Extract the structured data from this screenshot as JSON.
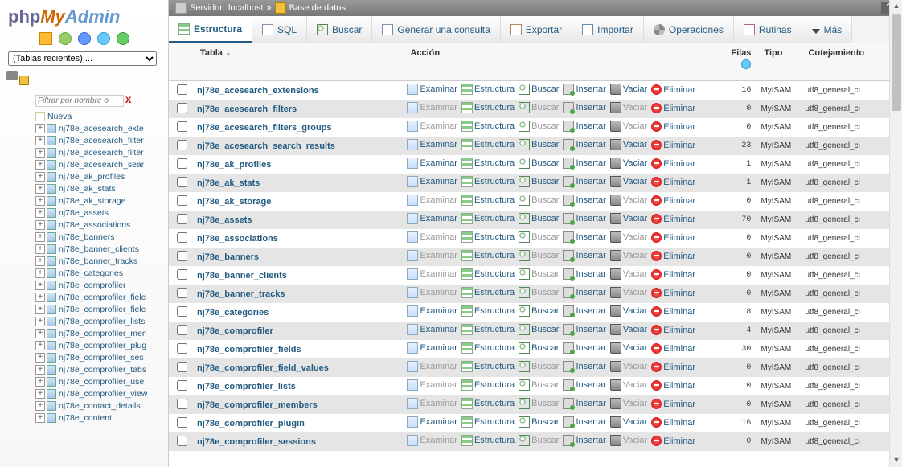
{
  "logo": {
    "p1": "php",
    "p2": "My",
    "p3": "Admin"
  },
  "sidebar": {
    "recent_placeholder": "(Tablas recientes) ...",
    "filter_placeholder": "Filtrar por nombre o",
    "filter_x": "X",
    "new_label": "Nueva",
    "tree": [
      "nj78e_acesearch_exte",
      "nj78e_acesearch_filter",
      "nj78e_acesearch_filter",
      "nj78e_acesearch_sear",
      "nj78e_ak_profiles",
      "nj78e_ak_stats",
      "nj78e_ak_storage",
      "nj78e_assets",
      "nj78e_associations",
      "nj78e_banners",
      "nj78e_banner_clients",
      "nj78e_banner_tracks",
      "nj78e_categories",
      "nj78e_comprofiler",
      "nj78e_comprofiler_fielc",
      "nj78e_comprofiler_fielc",
      "nj78e_comprofiler_lists",
      "nj78e_comprofiler_men",
      "nj78e_comprofiler_plug",
      "nj78e_comprofiler_ses",
      "nj78e_comprofiler_tabs",
      "nj78e_comprofiler_use",
      "nj78e_comprofiler_view",
      "nj78e_contact_details",
      "nj78e_content"
    ]
  },
  "breadcrumb": {
    "server_label": "Servidor:",
    "server_name": "localhost",
    "db_label": "Base de datos:",
    "db_name": ""
  },
  "topmenu": {
    "structure": "Estructura",
    "sql": "SQL",
    "search": "Buscar",
    "query": "Generar una consulta",
    "export": "Exportar",
    "import": "Importar",
    "operations": "Operaciones",
    "routines": "Rutinas",
    "more": "Más"
  },
  "headers": {
    "table": "Tabla",
    "action": "Acción",
    "rows": "Filas",
    "type": "Tipo",
    "collation": "Cotejamiento"
  },
  "actions": {
    "browse": "Examinar",
    "structure": "Estructura",
    "search": "Buscar",
    "insert": "Insertar",
    "empty": "Vaciar",
    "drop": "Eliminar"
  },
  "tables": [
    {
      "name": "nj78e_acesearch_extensions",
      "rows": 16,
      "type": "MyISAM",
      "collation": "utf8_general_ci",
      "empty": false
    },
    {
      "name": "nj78e_acesearch_filters",
      "rows": 0,
      "type": "MyISAM",
      "collation": "utf8_general_ci",
      "empty": true
    },
    {
      "name": "nj78e_acesearch_filters_groups",
      "rows": 0,
      "type": "MyISAM",
      "collation": "utf8_general_ci",
      "empty": true
    },
    {
      "name": "nj78e_acesearch_search_results",
      "rows": 23,
      "type": "MyISAM",
      "collation": "utf8_general_ci",
      "empty": false
    },
    {
      "name": "nj78e_ak_profiles",
      "rows": 1,
      "type": "MyISAM",
      "collation": "utf8_general_ci",
      "empty": false
    },
    {
      "name": "nj78e_ak_stats",
      "rows": 1,
      "type": "MyISAM",
      "collation": "utf8_general_ci",
      "empty": false
    },
    {
      "name": "nj78e_ak_storage",
      "rows": 0,
      "type": "MyISAM",
      "collation": "utf8_general_ci",
      "empty": true
    },
    {
      "name": "nj78e_assets",
      "rows": 70,
      "type": "MyISAM",
      "collation": "utf8_general_ci",
      "empty": false
    },
    {
      "name": "nj78e_associations",
      "rows": 0,
      "type": "MyISAM",
      "collation": "utf8_general_ci",
      "empty": true
    },
    {
      "name": "nj78e_banners",
      "rows": 0,
      "type": "MyISAM",
      "collation": "utf8_general_ci",
      "empty": true
    },
    {
      "name": "nj78e_banner_clients",
      "rows": 0,
      "type": "MyISAM",
      "collation": "utf8_general_ci",
      "empty": true
    },
    {
      "name": "nj78e_banner_tracks",
      "rows": 0,
      "type": "MyISAM",
      "collation": "utf8_general_ci",
      "empty": true
    },
    {
      "name": "nj78e_categories",
      "rows": 8,
      "type": "MyISAM",
      "collation": "utf8_general_ci",
      "empty": false
    },
    {
      "name": "nj78e_comprofiler",
      "rows": 4,
      "type": "MyISAM",
      "collation": "utf8_general_ci",
      "empty": false
    },
    {
      "name": "nj78e_comprofiler_fields",
      "rows": 30,
      "type": "MyISAM",
      "collation": "utf8_general_ci",
      "empty": false
    },
    {
      "name": "nj78e_comprofiler_field_values",
      "rows": 0,
      "type": "MyISAM",
      "collation": "utf8_general_ci",
      "empty": true
    },
    {
      "name": "nj78e_comprofiler_lists",
      "rows": 0,
      "type": "MyISAM",
      "collation": "utf8_general_ci",
      "empty": true
    },
    {
      "name": "nj78e_comprofiler_members",
      "rows": 0,
      "type": "MyISAM",
      "collation": "utf8_general_ci",
      "empty": true
    },
    {
      "name": "nj78e_comprofiler_plugin",
      "rows": 16,
      "type": "MyISAM",
      "collation": "utf8_general_ci",
      "empty": false
    },
    {
      "name": "nj78e_comprofiler_sessions",
      "rows": 0,
      "type": "MyISAM",
      "collation": "utf8_general_ci",
      "empty": true
    }
  ]
}
